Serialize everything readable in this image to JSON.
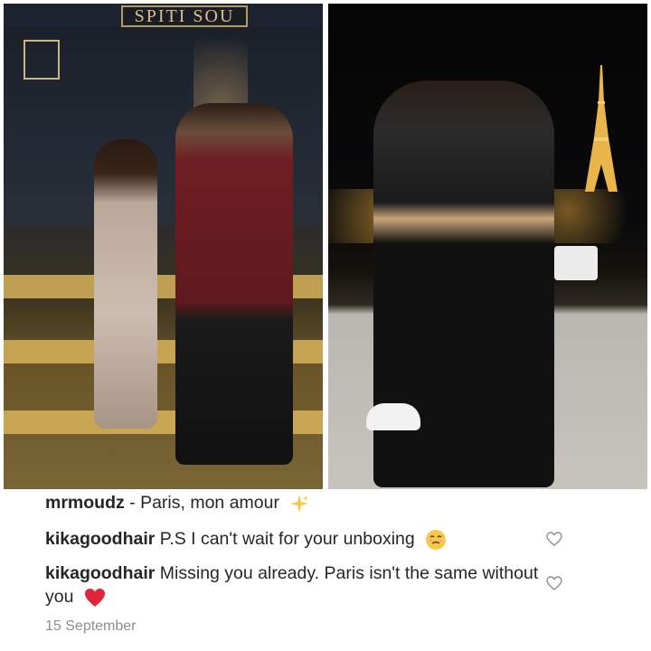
{
  "photos": {
    "left": {
      "sign_text": "SPITI SOU"
    },
    "right": {}
  },
  "comments": [
    {
      "username": "mrmoudz",
      "text": " - Paris, mon amour",
      "emoji_icon": "sparkles-icon"
    },
    {
      "username": "kikagoodhair",
      "text": " P.S I can't wait for your unboxing",
      "emoji_icon": "relieved-sweat-face-icon"
    },
    {
      "username": "kikagoodhair",
      "text": " Missing you already. Paris isn't the same without you",
      "emoji_icon": "red-heart-icon"
    }
  ],
  "date": "15 September",
  "colors": {
    "username": "#262626",
    "text": "#262626",
    "muted": "#8e8e8e",
    "heart": "#e0243a",
    "sparkle": "#f6c84c"
  }
}
